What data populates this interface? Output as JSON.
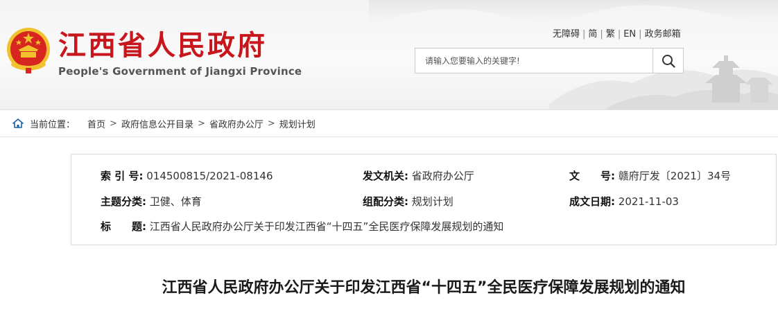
{
  "header": {
    "site_title": "江西省人民政府",
    "site_subtitle": "People's Government of Jiangxi Province",
    "top_links": [
      "无障碍",
      "简",
      "繁",
      "EN",
      "政务邮箱"
    ],
    "search_placeholder": "请输入您要输入的关键字!"
  },
  "breadcrumb": {
    "label": "当前位置：",
    "items": [
      "首页",
      "政府信息公开目录",
      "省政府办公厅",
      "规划计划"
    ],
    "separator": ">"
  },
  "info": {
    "index_label": "索 引 号:",
    "index_value": "014500815/2021-08146",
    "issuer_label": "发文机关:",
    "issuer_value": "省政府办公厅",
    "docno_label": "文　　号:",
    "docno_value": "赣府厅发〔2021〕34号",
    "topic_label": "主题分类:",
    "topic_value": "卫健、体育",
    "category_label": "组配分类:",
    "category_value": "规划计划",
    "date_label": "成文日期:",
    "date_value": "2021-11-03",
    "title_label": "标　　题:",
    "title_value": "江西省人民政府办公厅关于印发江西省“十四五”全民医疗保障发展规划的通知"
  },
  "document": {
    "title": "江西省人民政府办公厅关于印发江西省“十四五”全民医疗保障发展规划的通知"
  },
  "colors": {
    "brand_red": "#c8161d",
    "emblem_gold": "#f2c12e"
  },
  "icons": [
    "national-emblem-icon",
    "search-icon",
    "home-icon"
  ]
}
